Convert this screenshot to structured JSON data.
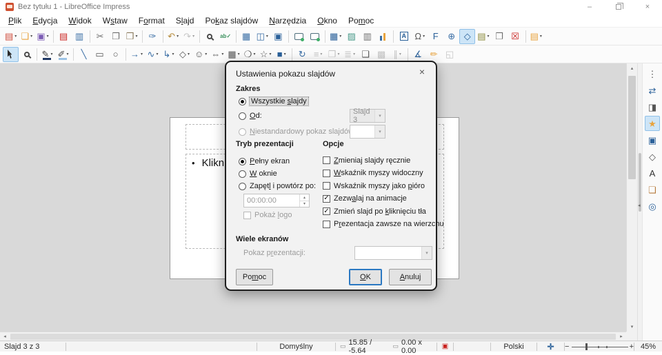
{
  "window": {
    "title": "Bez tytułu 1 - LibreOffice Impress",
    "controls": {
      "minimize": "–",
      "close": "×"
    }
  },
  "icons": {
    "chevron_down": "▾",
    "spin_up": "▴",
    "spin_down": "▾",
    "scroll_up": "▴",
    "scroll_down": "▾",
    "scroll_left": "◂",
    "scroll_right": "▸",
    "collapse_left": "◂",
    "modified": "▣",
    "fit_slide": "✛",
    "position": "▭",
    "size": "▭",
    "check": "✓"
  },
  "menubar": {
    "items": [
      {
        "name": "menu-plik",
        "t": "Plik",
        "u": 0
      },
      {
        "name": "menu-edycja",
        "t": "Edycja",
        "u": 0
      },
      {
        "name": "menu-widok",
        "t": "Widok",
        "u": 0
      },
      {
        "name": "menu-wstaw",
        "t": "Wstaw",
        "u": 1
      },
      {
        "name": "menu-format",
        "t": "Format",
        "u": 1
      },
      {
        "name": "menu-slajd",
        "t": "Slajd",
        "u": 1
      },
      {
        "name": "menu-pokaz-slajdow",
        "t": "Pokaz slajdów",
        "u": 2
      },
      {
        "name": "menu-narzedzia",
        "t": "Narzędzia",
        "u": 0
      },
      {
        "name": "menu-okno",
        "t": "Okno",
        "u": 0
      },
      {
        "name": "menu-pomoc",
        "t": "Pomoc",
        "u": 2
      }
    ]
  },
  "toolbar_standard": {
    "items": [
      {
        "name": "new-document-button",
        "glyph": "▤",
        "color": "#cf4c3c",
        "dd": true
      },
      {
        "name": "open-folder-button",
        "glyph": "❏",
        "color": "#e8a33d",
        "dd": true
      },
      {
        "name": "save-button",
        "glyph": "▣",
        "color": "#7b5bb5",
        "dd": true
      },
      {
        "sep": true
      },
      {
        "name": "export-pdf-button",
        "glyph": "▤",
        "color": "#c9211e"
      },
      {
        "name": "print-button",
        "glyph": "▥",
        "color": "#3a6ea5"
      },
      {
        "sep": true
      },
      {
        "name": "cut-button",
        "glyph": "✂",
        "color": "#6e6e6e"
      },
      {
        "name": "copy-button",
        "glyph": "❐",
        "color": "#6e6e6e"
      },
      {
        "name": "paste-button",
        "glyph": "❒",
        "color": "#8a7a5c",
        "dd": true
      },
      {
        "sep": true
      },
      {
        "name": "clone-formatting-button",
        "glyph": "✑",
        "color": "#3a6ea5"
      },
      {
        "sep": true
      },
      {
        "name": "undo-button",
        "glyph": "↶",
        "color": "#b58a3a",
        "dd": true
      },
      {
        "name": "redo-button",
        "glyph": "↷",
        "color": "#9a9a9a",
        "dd": true,
        "disabled": true
      },
      {
        "sep": true
      },
      {
        "name": "find-replace-button",
        "cls": "mag"
      },
      {
        "name": "spelling-button",
        "glyph": "ab✓",
        "color": "#3a915d",
        "small": true
      },
      {
        "sep": true
      },
      {
        "name": "display-grid-button",
        "glyph": "▦",
        "color": "#3a6ea5"
      },
      {
        "name": "snap-to-grid-button",
        "glyph": "◫",
        "color": "#3a6ea5",
        "dd": true
      },
      {
        "name": "helplines-while-moving-button",
        "glyph": "▣",
        "color": "#2a6099"
      },
      {
        "sep": true
      },
      {
        "name": "start-from-first-slide-button",
        "cls": "screen"
      },
      {
        "name": "start-from-current-slide-button",
        "cls": "screen"
      },
      {
        "sep": true
      },
      {
        "name": "insert-table-button",
        "glyph": "▦",
        "color": "#2a6099",
        "dd": true
      },
      {
        "name": "insert-image-button",
        "glyph": "▨",
        "color": "#4a9a8a"
      },
      {
        "name": "insert-media-button",
        "glyph": "▥",
        "color": "#6e6e6e"
      },
      {
        "name": "insert-chart-button",
        "cls": "bars"
      },
      {
        "sep": true
      },
      {
        "name": "insert-text-box-button",
        "glyph": "A",
        "color": "#2a6099",
        "boxed": true
      },
      {
        "name": "special-character-button",
        "glyph": "Ω",
        "color": "#555555",
        "dd": true
      },
      {
        "name": "fontwork-button",
        "glyph": "F",
        "color": "#2a6099"
      },
      {
        "name": "hyperlink-button",
        "glyph": "⊕",
        "color": "#3a6ea5"
      },
      {
        "name": "show-draw-functions-button",
        "glyph": "◇",
        "color": "#2a6099",
        "active": true
      },
      {
        "name": "new-slide-button",
        "glyph": "▤",
        "color": "#8a8a3a",
        "dd": true
      },
      {
        "name": "duplicate-slide-button",
        "glyph": "❐",
        "color": "#6e6e6e"
      },
      {
        "name": "delete-slide-button",
        "glyph": "☒",
        "color": "#c9211e"
      },
      {
        "sep": true
      },
      {
        "name": "slide-properties-button",
        "glyph": "▤",
        "color": "#e8a33d",
        "dd": true
      }
    ]
  },
  "toolbar_drawing": {
    "items": [
      {
        "name": "select-button",
        "cls": "cursor",
        "active": true
      },
      {
        "name": "zoom-button",
        "cls": "mag"
      },
      {
        "sep": true
      },
      {
        "name": "line-color-button",
        "glyph": "✎",
        "color": "#444444",
        "bar": "#1f3864",
        "dd": true
      },
      {
        "name": "fill-color-button",
        "glyph": "✐",
        "color": "#444444",
        "bar": "#9cc3e5",
        "dd": true
      },
      {
        "sep": true
      },
      {
        "name": "insert-line-button",
        "glyph": "╲",
        "color": "#3a6ea5"
      },
      {
        "name": "rectangle-button",
        "glyph": "▭",
        "color": "#555555"
      },
      {
        "name": "ellipse-button",
        "glyph": "○",
        "color": "#555555"
      },
      {
        "sep": true
      },
      {
        "name": "lines-and-arrows-button",
        "glyph": "→",
        "color": "#3a6ea5",
        "dd": true
      },
      {
        "name": "curve-button",
        "glyph": "∿",
        "color": "#3a6ea5",
        "dd": true
      },
      {
        "name": "connector-button",
        "glyph": "↳",
        "color": "#3a6ea5",
        "dd": true
      },
      {
        "name": "basic-shapes-button",
        "glyph": "◇",
        "color": "#555555",
        "dd": true
      },
      {
        "name": "symbol-shapes-button",
        "glyph": "☺",
        "color": "#555555",
        "dd": true
      },
      {
        "name": "block-arrows-button",
        "glyph": "⇔",
        "color": "#555555",
        "dd": true
      },
      {
        "name": "flowchart-button",
        "glyph": "▦",
        "color": "#555555",
        "dd": true
      },
      {
        "name": "callouts-button",
        "glyph": "❍",
        "color": "#555555",
        "dd": true
      },
      {
        "name": "stars-button",
        "glyph": "☆",
        "color": "#555555",
        "dd": true
      },
      {
        "name": "3d-objects-button",
        "glyph": "■",
        "color": "#2a6099",
        "dd": true
      },
      {
        "sep": true
      },
      {
        "name": "rotate-button",
        "glyph": "↻",
        "color": "#3a6ea5"
      },
      {
        "name": "align-objects-button",
        "glyph": "≡",
        "color": "#9a9a9a",
        "dd": true,
        "disabled": true
      },
      {
        "name": "arrange-button",
        "glyph": "❐",
        "color": "#9a9a9a",
        "dd": true,
        "disabled": true
      },
      {
        "name": "distribution-button",
        "glyph": "≣",
        "color": "#9a9a9a",
        "dd": true,
        "disabled": true
      },
      {
        "name": "shadow-button",
        "glyph": "❑",
        "color": "#555555"
      },
      {
        "name": "crop-image-button",
        "glyph": "▩",
        "color": "#9a9a9a",
        "disabled": true
      },
      {
        "name": "image-filter-button",
        "glyph": "∥",
        "color": "#9a9a9a",
        "dd": true,
        "disabled": true
      },
      {
        "sep": true
      },
      {
        "name": "edit-points-button",
        "glyph": "∡",
        "color": "#2a6099"
      },
      {
        "name": "glue-points-button",
        "glyph": "✏",
        "color": "#e8a33d"
      },
      {
        "name": "toggle-extrusion-button",
        "glyph": "◱",
        "color": "#9a9a9a",
        "disabled": true
      }
    ]
  },
  "canvas": {
    "bullet": "•",
    "bullet_text": "Klikni"
  },
  "dialog": {
    "title": "Ustawienia pokazu slajdów",
    "close": "×",
    "range": {
      "caption": "Zakres",
      "all_slides": {
        "t": "Wszystkie slajdy",
        "u": 10
      },
      "from": {
        "t": "Od:",
        "u": 0
      },
      "from_value": "Slajd 3",
      "custom": {
        "t": "Niestandardowy pokaz slajdów:",
        "u": 0
      },
      "custom_value": ""
    },
    "mode": {
      "caption": "Tryb prezentacji",
      "fullscreen": {
        "t": "Pełny ekran",
        "u": 0
      },
      "window": {
        "t": "W oknie",
        "u": 0
      },
      "loop": {
        "t": "Zapętl i powtórz po:",
        "u": 5
      },
      "loop_value": "00:00:00",
      "logo": {
        "t": "Pokaż logo",
        "u": 6
      }
    },
    "options": {
      "caption": "Opcje",
      "items": [
        {
          "name": "option-change-slides-manually",
          "t": "Zmieniaj slajdy ręcznie",
          "u": 0,
          "checked": false
        },
        {
          "name": "option-mouse-pointer-visible",
          "t": "Wskaźnik myszy widoczny",
          "u": 0,
          "checked": false
        },
        {
          "name": "option-mouse-pointer-as-pen",
          "t": "Wskaźnik myszy jako pióro",
          "u": 20,
          "checked": false
        },
        {
          "name": "option-animations-allowed",
          "t": "Zezwalaj na animacje",
          "u": 4,
          "checked": true
        },
        {
          "name": "option-change-slide-on-background-click",
          "t": "Zmień slajd po kliknięciu tła",
          "u": 15,
          "checked": true
        },
        {
          "name": "option-presentation-always-on-top",
          "t": "Prezentacja zawsze na wierzchu",
          "u": 1,
          "checked": false
        }
      ]
    },
    "multi": {
      "caption": "Wiele ekranów",
      "label": {
        "t": "Pokaz prezentacji:",
        "u": 7
      },
      "value": ""
    },
    "buttons": {
      "help": {
        "t": "Pomoc",
        "u": 2
      },
      "ok": {
        "t": "OK",
        "u": 0
      },
      "cancel": {
        "t": "Anuluj",
        "u": 0
      }
    }
  },
  "sidebar": {
    "items": [
      {
        "name": "sidebar-menu-button",
        "glyph": "⋮",
        "color": "#555555"
      },
      {
        "name": "properties-panel-button",
        "glyph": "⇄",
        "color": "#2a6099"
      },
      {
        "name": "slide-transition-panel-button",
        "glyph": "◨",
        "color": "#555555"
      },
      {
        "name": "animation-panel-button",
        "glyph": "★",
        "color": "#e8a33d",
        "active": true
      },
      {
        "name": "master-slides-panel-button",
        "glyph": "▣",
        "color": "#2a6099"
      },
      {
        "name": "shapes-panel-button",
        "glyph": "◇",
        "color": "#555555"
      },
      {
        "name": "styles-panel-button",
        "glyph": "A",
        "color": "#333333"
      },
      {
        "name": "gallery-panel-button",
        "glyph": "❏",
        "color": "#b5793a"
      },
      {
        "name": "navigator-panel-button",
        "glyph": "◎",
        "color": "#2a6099"
      }
    ]
  },
  "statusbar": {
    "slide": "Slajd 3 z 3",
    "layout": "Domyślny",
    "position": "15.85 / -5.64",
    "size": "0.00 x 0.00",
    "language": "Polski",
    "zoom_minus": "−",
    "zoom_plus": "+",
    "zoom": "45%"
  }
}
